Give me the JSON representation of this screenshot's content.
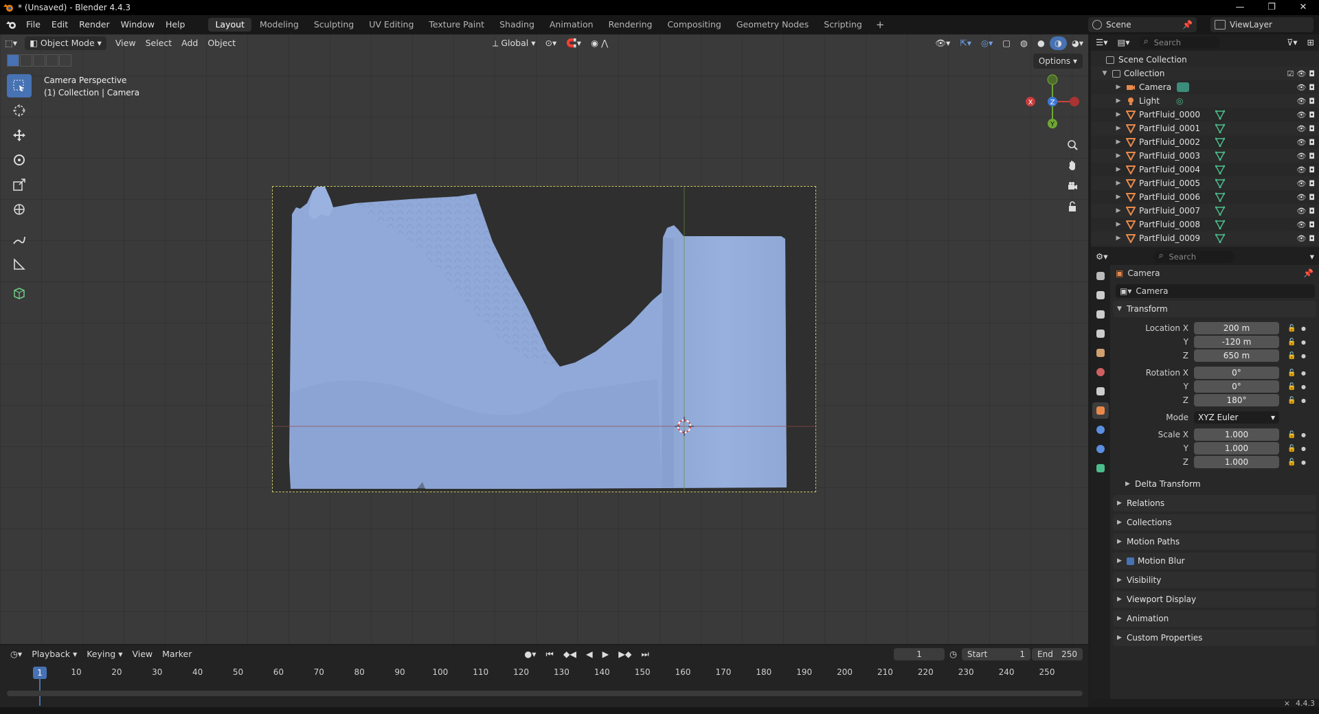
{
  "window": {
    "title": "* (Unsaved) - Blender 4.4.3",
    "buttons": [
      "—",
      "❐",
      "✕"
    ]
  },
  "menus": [
    "File",
    "Edit",
    "Render",
    "Window",
    "Help"
  ],
  "workspaces": [
    "Layout",
    "Modeling",
    "Sculpting",
    "UV Editing",
    "Texture Paint",
    "Shading",
    "Animation",
    "Rendering",
    "Compositing",
    "Geometry Nodes",
    "Scripting"
  ],
  "active_workspace": "Layout",
  "scene": {
    "name": "Scene",
    "view_layer": "ViewLayer"
  },
  "viewport": {
    "mode": "Object Mode",
    "menus": [
      "View",
      "Select",
      "Add",
      "Object"
    ],
    "orientation": "Global",
    "options_label": "Options",
    "info_line1": "Camera Perspective",
    "info_line2": "(1) Collection | Camera",
    "gizmo": {
      "x": "X",
      "y": "Y",
      "z": "Z"
    }
  },
  "outliner": {
    "search_placeholder": "Search",
    "root": "Scene Collection",
    "collection": "Collection",
    "items": [
      {
        "name": "Camera",
        "type": "camera"
      },
      {
        "name": "Light",
        "type": "light"
      },
      {
        "name": "PartFluid_0000",
        "type": "mesh"
      },
      {
        "name": "PartFluid_0001",
        "type": "mesh"
      },
      {
        "name": "PartFluid_0002",
        "type": "mesh"
      },
      {
        "name": "PartFluid_0003",
        "type": "mesh"
      },
      {
        "name": "PartFluid_0004",
        "type": "mesh"
      },
      {
        "name": "PartFluid_0005",
        "type": "mesh"
      },
      {
        "name": "PartFluid_0006",
        "type": "mesh"
      },
      {
        "name": "PartFluid_0007",
        "type": "mesh"
      },
      {
        "name": "PartFluid_0008",
        "type": "mesh"
      },
      {
        "name": "PartFluid_0009",
        "type": "mesh"
      }
    ]
  },
  "properties": {
    "search_placeholder": "Search",
    "object_name": "Camera",
    "datablock_name": "Camera",
    "transform_label": "Transform",
    "location_label": "Location X",
    "location": [
      "200 m",
      "-120 m",
      "650 m"
    ],
    "rotation_label": "Rotation X",
    "rotation": [
      "0°",
      "0°",
      "180°"
    ],
    "mode_label": "Mode",
    "mode_value": "XYZ Euler",
    "scale_label": "Scale X",
    "scale": [
      "1.000",
      "1.000",
      "1.000"
    ],
    "axis_y": "Y",
    "axis_z": "Z",
    "delta_transform": "Delta Transform",
    "panels": [
      "Relations",
      "Collections",
      "Motion Paths",
      "Motion Blur",
      "Visibility",
      "Viewport Display",
      "Animation",
      "Custom Properties"
    ]
  },
  "timeline": {
    "menus": [
      "Playback",
      "Keying",
      "View",
      "Marker"
    ],
    "current_frame": "1",
    "start_label": "Start",
    "start": "1",
    "end_label": "End",
    "end": "250",
    "ticks": [
      "10",
      "20",
      "30",
      "40",
      "50",
      "60",
      "70",
      "80",
      "90",
      "100",
      "110",
      "120",
      "130",
      "140",
      "150",
      "160",
      "170",
      "180",
      "190",
      "200",
      "210",
      "220",
      "230",
      "240",
      "250"
    ],
    "cursor_label": "1"
  },
  "status": {
    "version": "4.4.3"
  },
  "colors": {
    "accent": "#4772b3",
    "mesh": "#8fa9d8",
    "orange": "#e8894a"
  }
}
